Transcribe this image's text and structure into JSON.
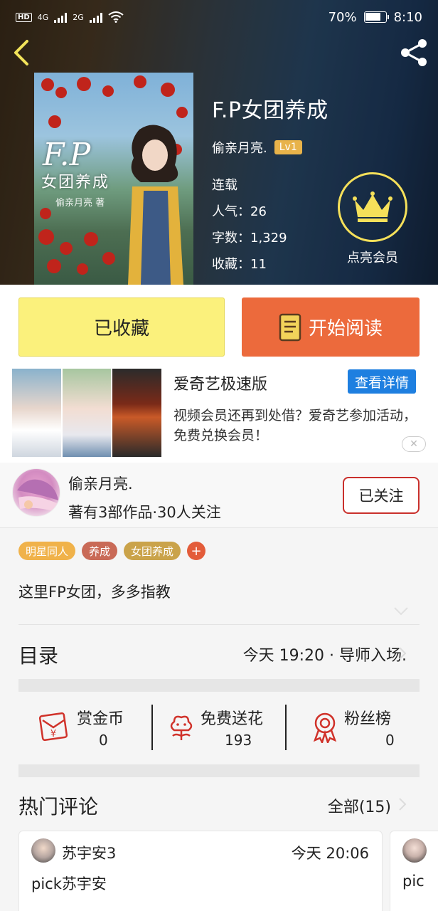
{
  "status_bar": {
    "hd": "HD",
    "net1": "4G",
    "net2": "2G",
    "battery_pct": "70%",
    "time": "8:10"
  },
  "header": {
    "back_icon": "chevron-left-icon",
    "share_icon": "share-icon"
  },
  "book": {
    "cover_title": "F.P",
    "cover_subtitle": "女团养成",
    "cover_author": "偷亲月亮 著",
    "title": "F.P女团养成",
    "author": "偷亲月亮.",
    "level": "Lv1",
    "status": "连载",
    "popularity": "人气：26",
    "word_count": "字数：1,329",
    "collections": "收藏：11"
  },
  "vip": {
    "label": "点亮会员",
    "icon": "crown-icon"
  },
  "actions": {
    "collect_label": "已收藏",
    "read_label": "开始阅读"
  },
  "ad": {
    "title": "爱奇艺极速版",
    "detail_button": "查看详情",
    "text": "视频会员还再到处借？爱奇艺参加活动，免费兑换会员！",
    "close_symbol": "✕"
  },
  "author_card": {
    "name": "偷亲月亮.",
    "stats": "著有3部作品·30人关注",
    "follow_label": "已关注"
  },
  "tags": [
    {
      "label": "明星同人",
      "color": "#f0b24a"
    },
    {
      "label": "养成",
      "color": "#c96a57"
    },
    {
      "label": "女团养成",
      "color": "#caa34a"
    }
  ],
  "tag_add": "+",
  "intro": "这里FP女团，多多指教",
  "toc": {
    "title": "目录",
    "latest": "今天 19:20 · 导师入场."
  },
  "rewards": [
    {
      "label": "赏金币",
      "count": "0",
      "icon": "red-envelope-icon"
    },
    {
      "label": "免费送花",
      "count": "193",
      "icon": "flower-icon"
    },
    {
      "label": "粉丝榜",
      "count": "0",
      "icon": "medal-icon"
    }
  ],
  "comments": {
    "title": "热门评论",
    "all_label": "全部(15)",
    "items": [
      {
        "name": "苏宇安3",
        "time": "今天 20:06",
        "text": "pick苏宇安"
      },
      {
        "name": "",
        "time": "",
        "text": "pic"
      }
    ]
  },
  "colors": {
    "collect_bg": "#fbf17c",
    "read_bg": "#ec6a3c",
    "detail_bg": "#1e7fe0",
    "follow_border": "#c9302c",
    "vip_ring": "#f5e05a",
    "level_badge": "#e8b34a"
  }
}
